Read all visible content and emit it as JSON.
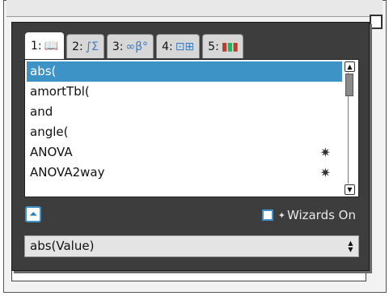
{
  "tabs": [
    {
      "num": "1:",
      "icon": "book-icon",
      "glyph": "📖",
      "active": true
    },
    {
      "num": "2:",
      "icon": "calculus-icon",
      "glyph": "∫Σ",
      "active": false
    },
    {
      "num": "3:",
      "icon": "symbols-icon",
      "glyph": "∞β°",
      "active": false
    },
    {
      "num": "4:",
      "icon": "list-template-icon",
      "glyph": "⊡⊞",
      "active": false
    },
    {
      "num": "5:",
      "icon": "library-icon",
      "glyph": "▮▮▮",
      "active": false
    }
  ],
  "catalog": {
    "items": [
      {
        "label": "abs(",
        "selected": true,
        "wizard": false
      },
      {
        "label": "amortTbl(",
        "selected": false,
        "wizard": false
      },
      {
        "label": "and",
        "selected": false,
        "wizard": false
      },
      {
        "label": "angle(",
        "selected": false,
        "wizard": false
      },
      {
        "label": "ANOVA",
        "selected": false,
        "wizard": true
      },
      {
        "label": "ANOVA2way",
        "selected": false,
        "wizard": true
      }
    ],
    "wizard_glyph": "✷"
  },
  "wizards": {
    "label": "Wizards On",
    "checked": false
  },
  "syntax": {
    "text": "abs(Value)"
  },
  "colors": {
    "selection": "#3e93c6",
    "dialog": "#3d3d3d"
  }
}
